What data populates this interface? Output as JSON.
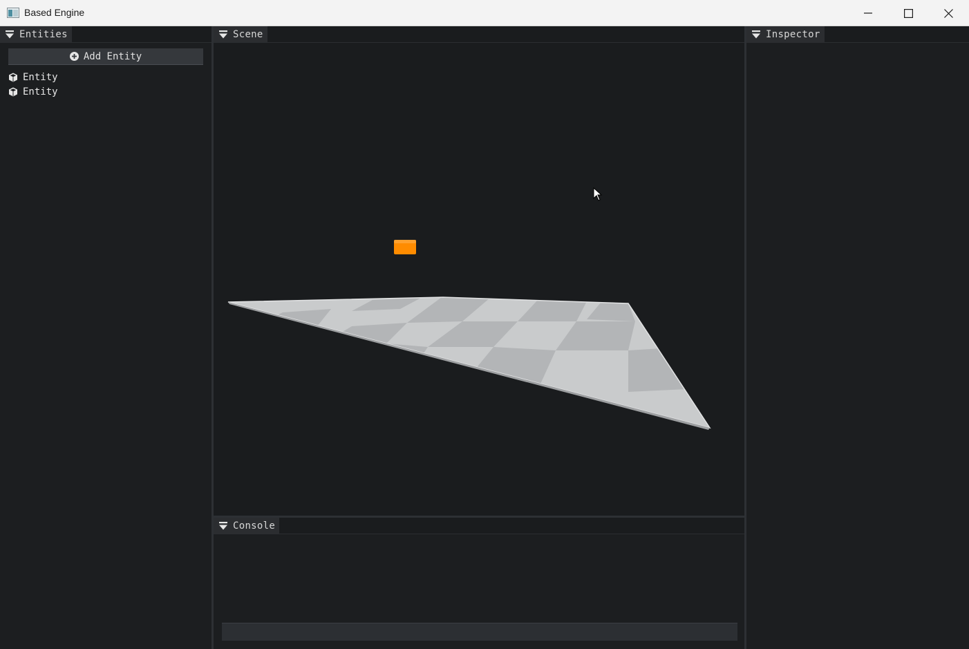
{
  "window": {
    "title": "Based Engine"
  },
  "panels": {
    "entities": {
      "tab_label": "Entities",
      "add_button_label": "Add Entity",
      "items": [
        {
          "label": "Entity",
          "icon": "cube-icon"
        },
        {
          "label": "Entity",
          "icon": "cube-icon"
        }
      ]
    },
    "scene": {
      "tab_label": "Scene",
      "objects": [
        {
          "name": "orange cube",
          "color": "#ff8c00"
        },
        {
          "name": "checkered floor plane",
          "colors": [
            "#c9cbcc",
            "#b2b4b6"
          ]
        }
      ]
    },
    "console": {
      "tab_label": "Console",
      "input_value": ""
    },
    "inspector": {
      "tab_label": "Inspector"
    }
  },
  "colors": {
    "background": "#1c1e20",
    "tab": "#2b2d30",
    "button": "#35383c",
    "accent_object": "#ff8c00"
  }
}
